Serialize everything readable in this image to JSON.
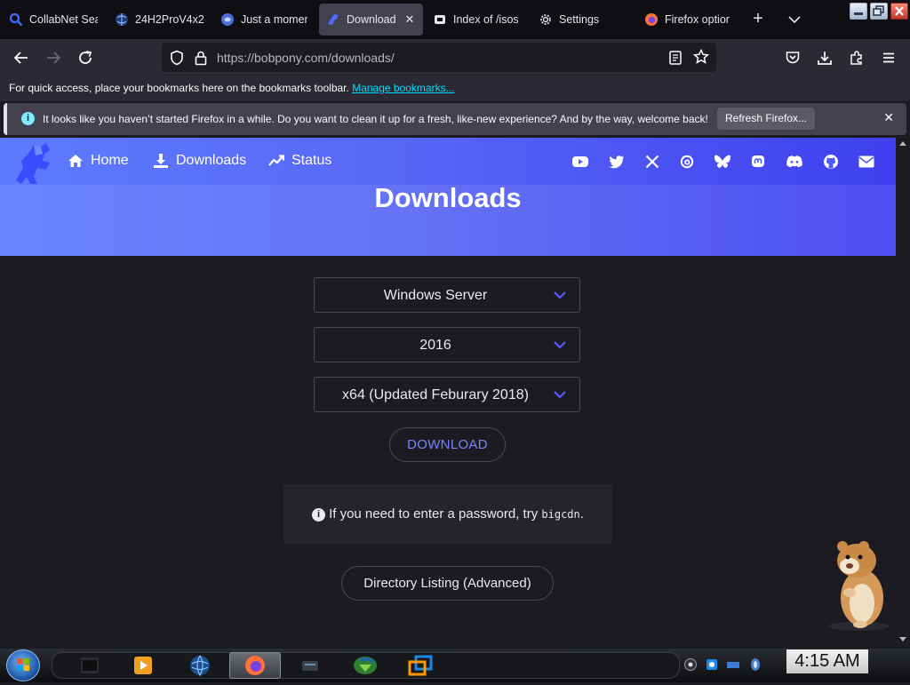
{
  "tabs": [
    {
      "title": "CollabNet Sea",
      "icon": "magnifier-icon"
    },
    {
      "title": "24H2ProV4x2",
      "icon": "globe-icon"
    },
    {
      "title": "Just a momen",
      "icon": "firefox-globe-icon"
    },
    {
      "title": "Download",
      "icon": "bobpony-icon"
    },
    {
      "title": "Index of /isos/",
      "icon": "apache-icon"
    },
    {
      "title": "Settings",
      "icon": "gear-icon"
    },
    {
      "title": "Firefox option",
      "icon": "firefox-icon"
    }
  ],
  "active_tab": "Download",
  "toolbar": {
    "url": "https://bobpony.com/downloads/",
    "close_tab_glyph": "✕",
    "new_tab_glyph": "+"
  },
  "bookmarks": {
    "text": "For quick access, place your bookmarks here on the bookmarks toolbar.",
    "link": "Manage bookmarks..."
  },
  "notification": {
    "text": "It looks like you haven’t started Firefox in a while. Do you want to clean it up for a fresh, like-new experience? And by the way, welcome back!",
    "button": "Refresh Firefox...",
    "close": "✕",
    "icon_glyph": "i"
  },
  "site": {
    "nav": [
      "Home",
      "Downloads",
      "Status"
    ],
    "social_icons": [
      "youtube-icon",
      "twitter-icon",
      "x-icon",
      "threads-icon",
      "bluesky-icon",
      "mastodon-icon",
      "discord-icon",
      "github-icon",
      "mail-icon"
    ],
    "title": "Downloads"
  },
  "selects": {
    "product": "Windows Server",
    "version": "2016",
    "build": "x64 (Updated Feburary 2018)"
  },
  "download_button": "DOWNLOAD",
  "info": {
    "text": "If you need to enter a password, try",
    "code": "bigcdn",
    "end": ".",
    "icon_glyph": "i"
  },
  "directory_button": "Directory Listing (Advanced)",
  "taskbar": {
    "clock": "4:15 AM"
  },
  "colors": {
    "hero_start": "#5d7bff",
    "hero_end": "#3f3ff0",
    "accent_link": "#7b83ff",
    "chevron": "#5b5bff"
  }
}
